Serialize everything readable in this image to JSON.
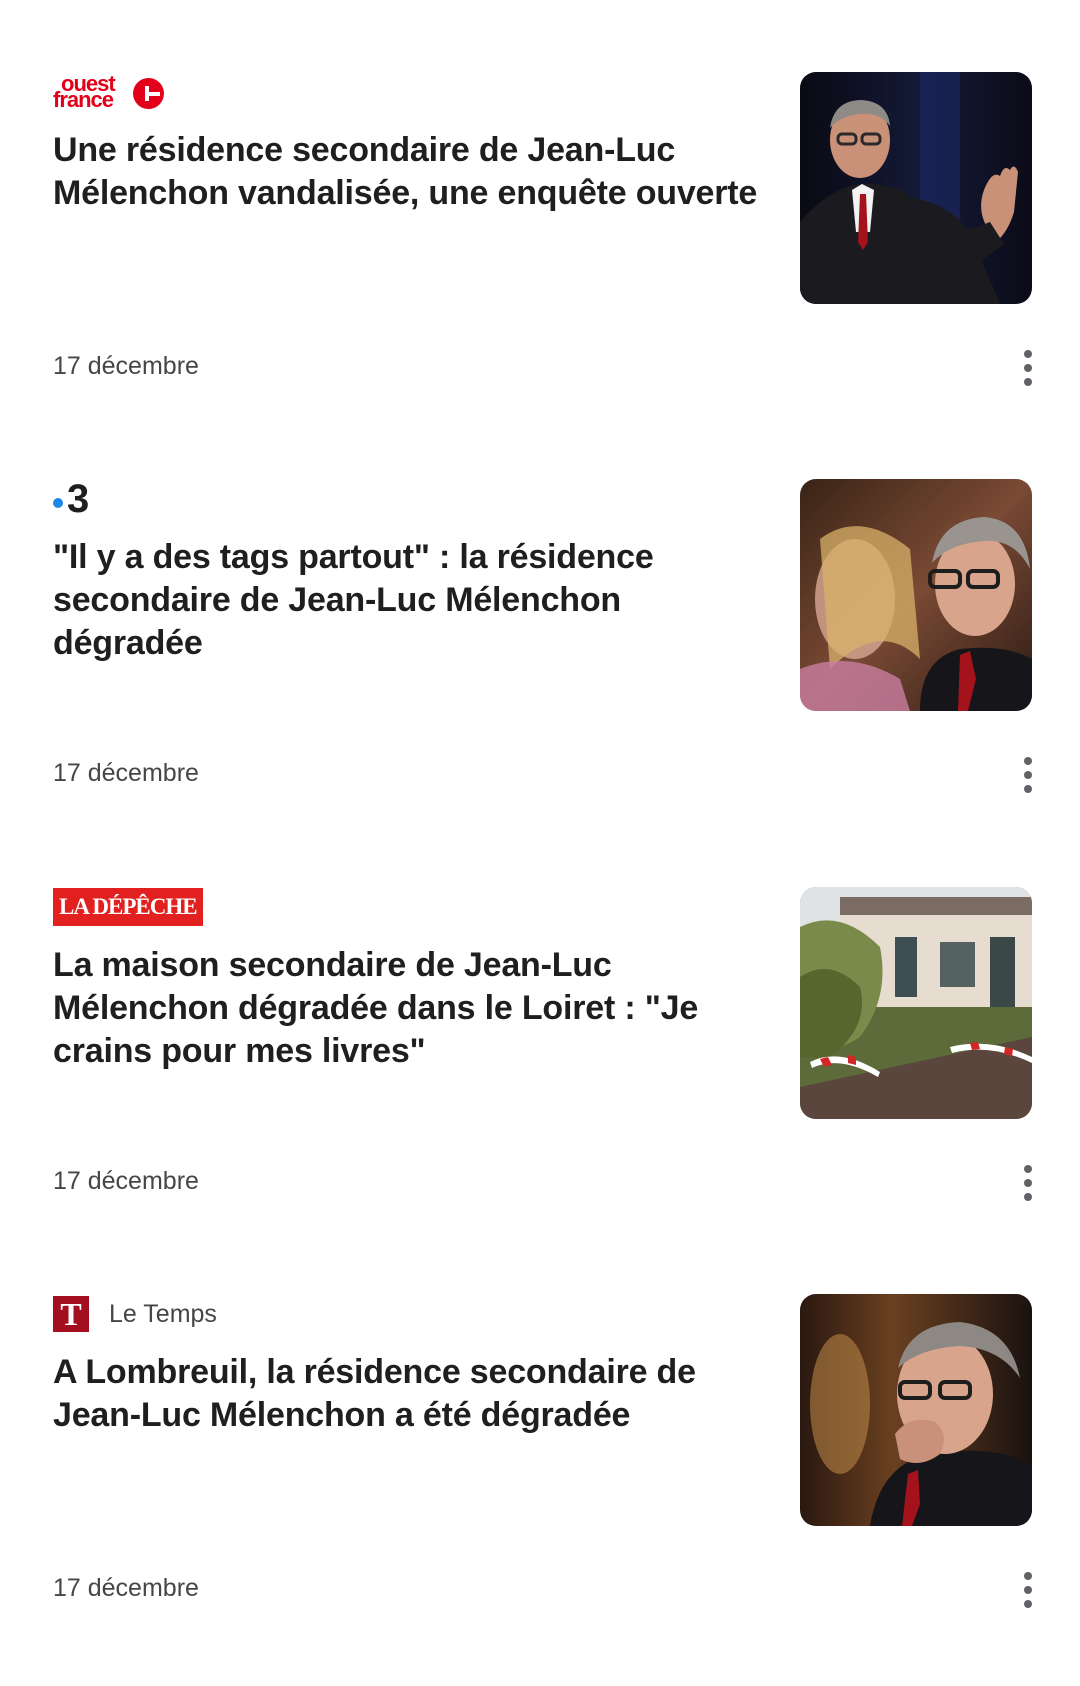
{
  "articles": [
    {
      "source": {
        "wordmark_line1": "ouest",
        "wordmark_line2": "france",
        "logo_color": "#e2001a"
      },
      "headline": "Une résidence secondaire de Jean-Luc Mélenchon vandalisée, une enquête ouverte",
      "date": "17 décembre",
      "image_icon": "photo-man-speaking-icon"
    },
    {
      "source": {
        "wordmark": "3",
        "dot_color": "#1e88e5"
      },
      "headline": "\"Il y a des tags partout\" : la résidence secondaire de Jean-Luc Mélenchon dégradée",
      "date": "17 décembre",
      "image_icon": "photo-portrait-icon"
    },
    {
      "source": {
        "wordmark": "LA DÉPÊCHE",
        "logo_color": "#e1201f"
      },
      "headline": "La maison secondaire de Jean-Luc Mélenchon dégradée dans le Loiret : \"Je crains pour mes livres\"",
      "date": "17 décembre",
      "image_icon": "photo-house-garden-icon"
    },
    {
      "source": {
        "logo_letter": "T",
        "name": "Le Temps",
        "logo_color": "#a30f1e"
      },
      "headline": "A Lombreuil, la résidence secondaire de Jean-Luc Mélenchon a été dégradée",
      "date": "17 décembre",
      "image_icon": "photo-portrait-thinking-icon"
    }
  ],
  "icons": {
    "more": "more-vert-icon"
  }
}
